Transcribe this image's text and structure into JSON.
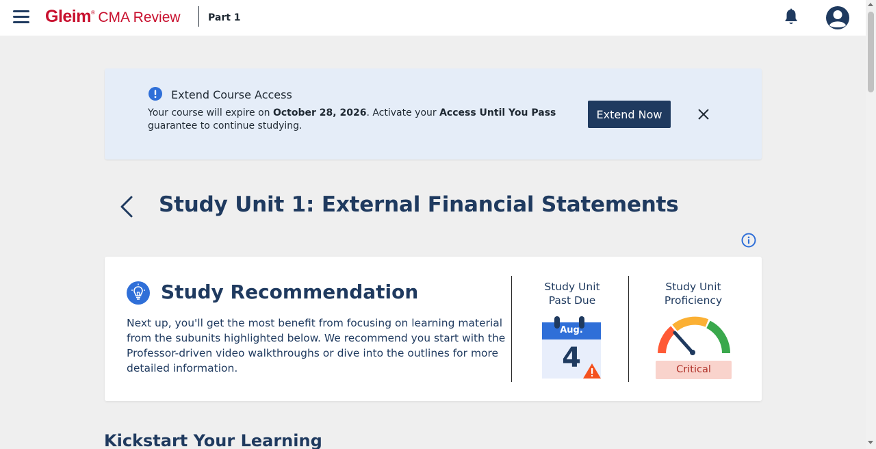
{
  "header": {
    "logo_brand": "Gleim",
    "logo_mark": "®",
    "logo_product": "CMA Review",
    "part": "Part 1"
  },
  "banner": {
    "title": "Extend Course Access",
    "text_prefix": "Your course will expire on ",
    "expiry_date": "October 28, 2026",
    "text_middle": ". Activate your ",
    "guarantee": "Access Until You Pass",
    "text_suffix": " guarantee to continue studying.",
    "button_label": "Extend Now"
  },
  "page": {
    "title": "Study Unit 1: External Financial Statements"
  },
  "recommendation": {
    "title": "Study Recommendation",
    "text": "Next up, you'll get the most benefit from focusing on learning material from the subunits highlighted below. We recommend you start with the Professor-driven video walkthroughs or dive into the outlines for more detailed information.",
    "due_label": "Study Unit Past Due",
    "due_month": "Aug.",
    "due_day": "4",
    "proficiency_label": "Study Unit Proficiency",
    "proficiency_status": "Critical",
    "proficiency_level": "critical"
  },
  "next_section": {
    "title": "Kickstart Your Learning"
  },
  "colors": {
    "navy": "#1f3a5f",
    "brand_red": "#c8102e",
    "banner_bg": "#e5edf8",
    "icon_blue": "#2f6fd8",
    "critical_bg": "#f9d3cc",
    "warning_red": "#f4511e"
  },
  "icons": {
    "menu": "hamburger-icon",
    "notifications": "bell-icon",
    "account": "user-avatar-icon",
    "banner": "exclamation-circle-icon",
    "close": "close-icon",
    "back": "chevron-left-icon",
    "info": "info-icon",
    "recommendation": "lightbulb-icon",
    "calendar": "calendar-icon",
    "warning": "warning-triangle-icon",
    "gauge": "gauge-icon"
  }
}
